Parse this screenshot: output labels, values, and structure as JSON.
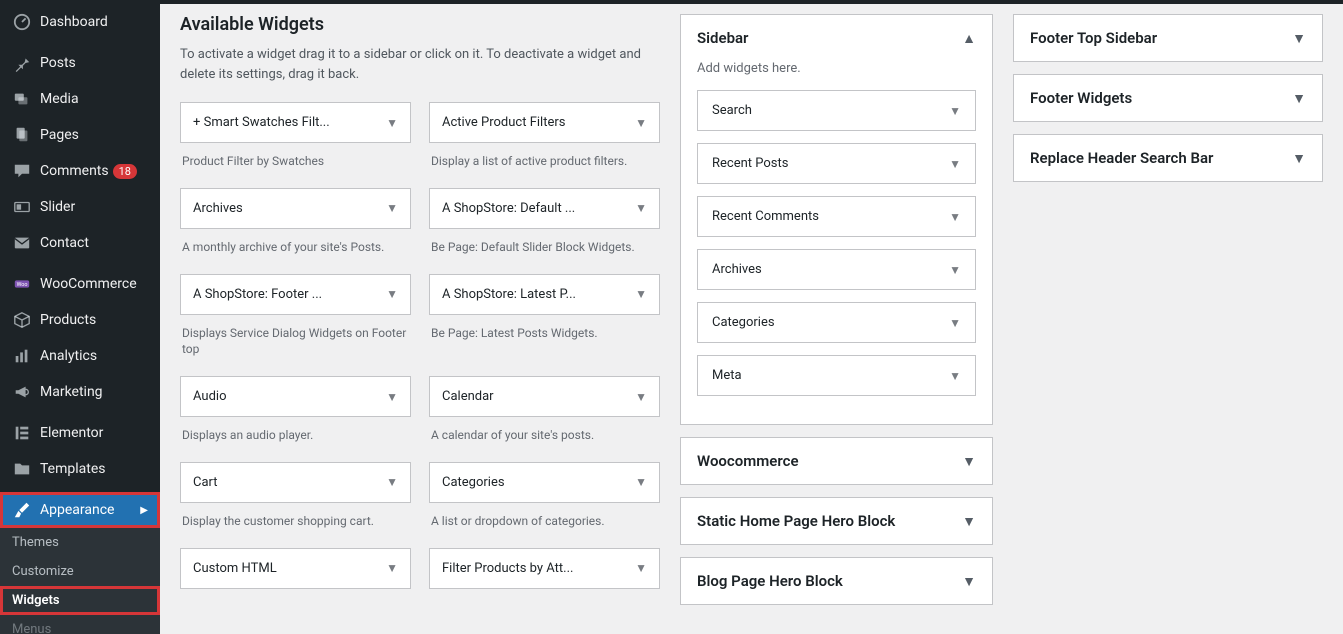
{
  "sidebar_menu": {
    "dashboard": "Dashboard",
    "posts": "Posts",
    "media": "Media",
    "pages": "Pages",
    "comments": "Comments",
    "comments_badge": "18",
    "slider": "Slider",
    "contact": "Contact",
    "woocommerce": "WooCommerce",
    "products": "Products",
    "analytics": "Analytics",
    "marketing": "Marketing",
    "elementor": "Elementor",
    "templates": "Templates",
    "appearance": "Appearance",
    "submenu": {
      "themes": "Themes",
      "customize": "Customize",
      "widgets": "Widgets",
      "menus": "Menus"
    }
  },
  "available": {
    "heading": "Available Widgets",
    "help": "To activate a widget drag it to a sidebar or click on it. To deactivate a widget and delete its settings, drag it back.",
    "widgets": [
      {
        "title": "+ Smart Swatches Filt...",
        "desc": "Product Filter by Swatches"
      },
      {
        "title": "Active Product Filters",
        "desc": "Display a list of active product filters."
      },
      {
        "title": "Archives",
        "desc": "A monthly archive of your site's Posts."
      },
      {
        "title": "A ShopStore: Default ...",
        "desc": "Be Page: Default Slider Block Widgets."
      },
      {
        "title": "A ShopStore: Footer ...",
        "desc": "Displays Service Dialog Widgets on Footer top"
      },
      {
        "title": "A ShopStore: Latest P...",
        "desc": "Be Page: Latest Posts Widgets."
      },
      {
        "title": "Audio",
        "desc": "Displays an audio player."
      },
      {
        "title": "Calendar",
        "desc": "A calendar of your site's posts."
      },
      {
        "title": "Cart",
        "desc": "Display the customer shopping cart."
      },
      {
        "title": "Categories",
        "desc": "A list or dropdown of categories."
      },
      {
        "title": "Custom HTML",
        "desc": ""
      },
      {
        "title": "Filter Products by Att...",
        "desc": ""
      }
    ]
  },
  "areas_mid": [
    {
      "title": "Sidebar",
      "expanded": true,
      "desc": "Add widgets here.",
      "widgets": [
        "Search",
        "Recent Posts",
        "Recent Comments",
        "Archives",
        "Categories",
        "Meta"
      ]
    },
    {
      "title": "Woocommerce",
      "expanded": false
    },
    {
      "title": "Static Home Page Hero Block",
      "expanded": false
    },
    {
      "title": "Blog Page Hero Block",
      "expanded": false
    }
  ],
  "areas_right": [
    {
      "title": "Footer Top Sidebar"
    },
    {
      "title": "Footer Widgets"
    },
    {
      "title": "Replace Header Search Bar"
    }
  ]
}
